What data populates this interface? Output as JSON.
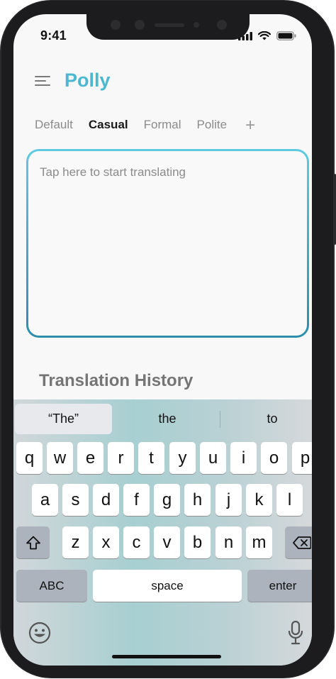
{
  "status": {
    "time": "9:41"
  },
  "app": {
    "title": "Polly"
  },
  "tabs": [
    {
      "label": "Default",
      "active": false
    },
    {
      "label": "Casual",
      "active": true
    },
    {
      "label": "Formal",
      "active": false
    },
    {
      "label": "Polite",
      "active": false
    }
  ],
  "tabs_add_label": "+",
  "input": {
    "placeholder": "Tap here to start translating"
  },
  "history": {
    "title": "Translation History"
  },
  "keyboard": {
    "suggestions": [
      "“The”",
      "the",
      "to"
    ],
    "row1": [
      "q",
      "w",
      "e",
      "r",
      "t",
      "y",
      "u",
      "i",
      "o",
      "p"
    ],
    "row2": [
      "a",
      "s",
      "d",
      "f",
      "g",
      "h",
      "j",
      "k",
      "l"
    ],
    "row3": [
      "z",
      "x",
      "c",
      "v",
      "b",
      "n",
      "m"
    ],
    "abc_label": "ABC",
    "space_label": "space",
    "enter_label": "enter",
    "icons": [
      "shift-icon",
      "backspace-icon",
      "emoji-icon",
      "microphone-icon"
    ]
  },
  "colors": {
    "accent": "#4ab9cf",
    "border_top": "#5fcbe0",
    "border_bottom": "#2c8ea8"
  }
}
